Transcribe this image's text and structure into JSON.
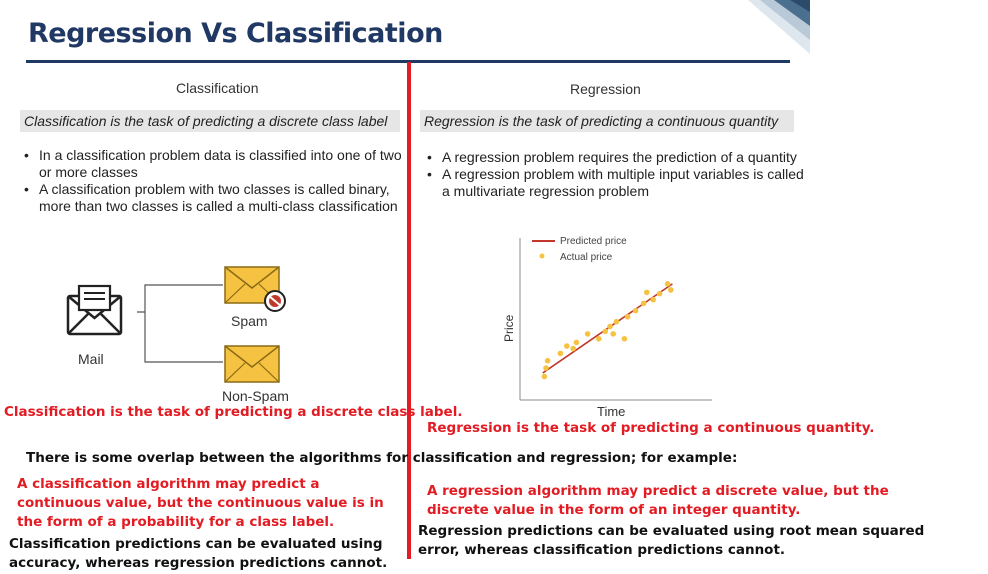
{
  "title": "Regression Vs Classification",
  "classification": {
    "heading": "Classification",
    "definition": "Classification is the task of predicting a discrete class label",
    "bullets": [
      "In a classification problem data is classified into one of two or more classes",
      "A classification problem with two classes is called binary, more than two classes is called a multi-class classification"
    ],
    "diagram": {
      "mail_label": "Mail",
      "spam_label": "Spam",
      "nonspam_label": "Non-Spam"
    },
    "red_statement": "Classification is the task of predicting a discrete class label."
  },
  "regression": {
    "heading": "Regression",
    "definition": "Regression is the task of predicting a continuous quantity",
    "bullets": [
      "A regression problem requires the prediction of a quantity",
      "A regression problem with multiple input variables is called a multivariate regression problem"
    ],
    "red_statement": "Regression is the task of predicting a continuous quantity."
  },
  "overlap_statement": "There is some overlap between the algorithms for classification and regression; for example:",
  "classification_overlap": "A classification algorithm may predict a continuous value, but the continuous value is in the form of a probability for a class label.",
  "regression_overlap": "A regression algorithm may predict a discrete value, but the discrete value in the form of an integer quantity.",
  "classification_eval": "Classification predictions can be evaluated using accuracy, whereas regression predictions cannot.",
  "regression_eval": "Regression predictions can be evaluated using root mean squared error, whereas classification predictions cannot.",
  "colors": {
    "title": "#1f3864",
    "accent_red": "#e31b23",
    "envelope": "#f5c242",
    "point": "#f5c242",
    "line": "#c0392b"
  },
  "chart_data": {
    "type": "scatter",
    "xlabel": "Time",
    "ylabel": "Price",
    "legend": [
      "Predicted price",
      "Actual price"
    ],
    "legend_position": "top-left",
    "grid": false,
    "x_range": [
      0,
      10
    ],
    "y_range": [
      0,
      10
    ],
    "series": [
      {
        "name": "Actual price",
        "points": [
          [
            0.4,
            1.1
          ],
          [
            0.5,
            1.8
          ],
          [
            0.6,
            2.4
          ],
          [
            1.4,
            3.0
          ],
          [
            1.8,
            3.6
          ],
          [
            2.2,
            3.4
          ],
          [
            2.4,
            3.9
          ],
          [
            3.1,
            4.6
          ],
          [
            3.8,
            4.2
          ],
          [
            4.2,
            4.8
          ],
          [
            4.5,
            5.2
          ],
          [
            4.7,
            4.6
          ],
          [
            5.4,
            4.2
          ],
          [
            4.9,
            5.6
          ],
          [
            5.6,
            6.0
          ],
          [
            6.1,
            6.5
          ],
          [
            6.6,
            7.1
          ],
          [
            6.8,
            8.0
          ],
          [
            7.2,
            7.4
          ],
          [
            7.6,
            7.9
          ],
          [
            8.1,
            8.7
          ],
          [
            8.3,
            8.2
          ]
        ]
      },
      {
        "name": "Predicted price",
        "line": [
          [
            0.3,
            1.4
          ],
          [
            8.4,
            8.7
          ]
        ]
      }
    ]
  }
}
